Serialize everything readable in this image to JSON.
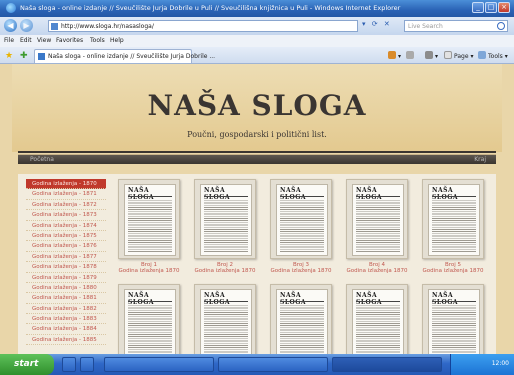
{
  "window": {
    "title": "Naša sloga - online izdanje // Sveučilište Jurja Dobrile u Puli // Sveučilišna knjižnica u Puli - Windows Internet Explorer"
  },
  "addressbar": {
    "url": "http://www.sloga.hr/nasasloga/",
    "search_placeholder": "Live Search"
  },
  "menu": [
    "File",
    "Edit",
    "View",
    "Favorites",
    "Tools",
    "Help"
  ],
  "tab": {
    "label": "Naša sloga - online izdanje // Sveučilište Jurja Dobrile ..."
  },
  "commandbar": {
    "page": "Page",
    "tools": "Tools"
  },
  "site": {
    "title": "NAŠA SLOGA",
    "subtitle": "Poučni, gospodarski i politični list.",
    "nav_left": "Početna",
    "nav_right": "Kraj"
  },
  "sidebar": {
    "years": [
      "Godina izlaženja - 1870",
      "Godina izlaženja - 1871",
      "Godina izlaženja - 1872",
      "Godina izlaženja - 1873",
      "Godina izlaženja - 1874",
      "Godina izlaženja - 1875",
      "Godina izlaženja - 1876",
      "Godina izlaženja - 1877",
      "Godina izlaženja - 1878",
      "Godina izlaženja - 1879",
      "Godina izlaženja - 1880",
      "Godina izlaženja - 1881",
      "Godina izlaženja - 1882",
      "Godina izlaženja - 1883",
      "Godina izlaženja - 1884",
      "Godina izlaženja - 1885"
    ],
    "active_index": 0
  },
  "issues": {
    "masthead": "NAŠA SLOGA",
    "row1": [
      {
        "title": "Broj 1",
        "year": "Godina izlaženja 1870"
      },
      {
        "title": "Broj 2",
        "year": "Godina izlaženja 1870"
      },
      {
        "title": "Broj 3",
        "year": "Godina izlaženja 1870"
      },
      {
        "title": "Broj 4",
        "year": "Godina izlaženja 1870"
      },
      {
        "title": "Broj 5",
        "year": "Godina izlaženja 1870"
      }
    ],
    "row2_count": 5
  },
  "taskbar": {
    "start": "start",
    "clock": "12:00"
  },
  "colors": {
    "accent": "#c0392b",
    "page_bg": "#e9d6a9",
    "title_text": "#3a3532"
  }
}
